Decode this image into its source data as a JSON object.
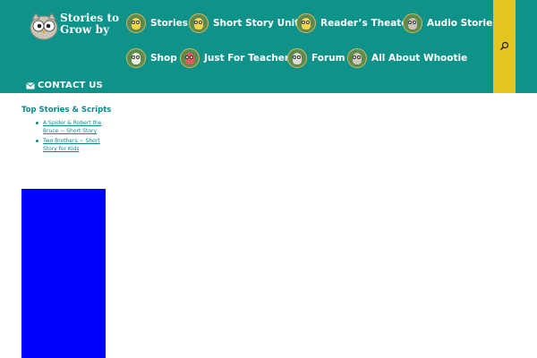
{
  "logo": {
    "text": "Stories to Grow by",
    "icon": "owl-logo-icon"
  },
  "nav": {
    "items": [
      {
        "label": "Stories",
        "icon": "owl-yellow-icon",
        "owl_color": "#f2d64b"
      },
      {
        "label": "Short Story Units",
        "icon": "owl-yellow-icon",
        "owl_color": "#f2d64b"
      },
      {
        "label": "Reader’s Theater",
        "icon": "owl-yellow-icon",
        "owl_color": "#f2d64b"
      },
      {
        "label": "Audio Stories",
        "icon": "owl-gray-icon",
        "owl_color": "#c7c2b5"
      },
      {
        "label": "Shop",
        "icon": "owl-white-icon",
        "owl_color": "#f2f0e6"
      },
      {
        "label": "Just For Teachers",
        "icon": "owl-red-icon",
        "owl_color": "#e25a5a"
      },
      {
        "label": "Forum",
        "icon": "owl-gray-icon",
        "owl_color": "#dcdcd0"
      },
      {
        "label": "All About Whootie",
        "icon": "owl-gray-icon",
        "owl_color": "#cfc9bb"
      }
    ],
    "contact_label": "CONTACT US",
    "contact_icon": "mail-icon"
  },
  "search": {
    "icon": "search-icon"
  },
  "widget": {
    "title": "Top Stories & Scripts",
    "links": [
      "A Spider & Robert the Bruce ~ Short Story",
      "Two Brothers ~ Short Story for Kids"
    ]
  },
  "colors": {
    "header_bg": "#0e928a",
    "search_bg": "#e4c51f",
    "link": "#0b8a8c",
    "ad_block": "#0000ff"
  }
}
